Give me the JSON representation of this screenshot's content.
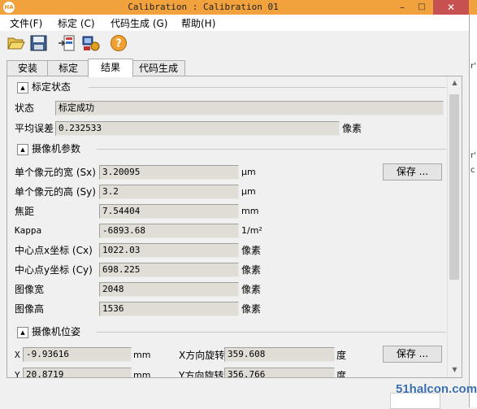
{
  "window": {
    "title": "Calibration : Calibration 01",
    "app_icon": "HA",
    "min": "–",
    "max": "□",
    "close": "✕"
  },
  "menu": [
    "文件(F)",
    "标定 (C)",
    "代码生成 (G)",
    "帮助(H)"
  ],
  "toolbar_icons": [
    "open-folder-icon",
    "save-disk-icon",
    "import-icon",
    "camera-settings-icon",
    "help-icon"
  ],
  "tabs": [
    "安装",
    "标定",
    "结果",
    "代码生成"
  ],
  "active_tab": "结果",
  "sections": {
    "calib_status": "标定状态",
    "camera_params": "摄像机参数",
    "camera_pose": "摄像机位姿"
  },
  "status": {
    "state_label": "状态",
    "state_value": "标定成功",
    "mean_error_label": "平均误差",
    "mean_error_value": "0.232533",
    "mean_error_unit": "像素"
  },
  "params": [
    {
      "label": "单个像元的宽 (Sx)",
      "value": "3.20095",
      "unit": "μm"
    },
    {
      "label": "单个像元的高 (Sy)",
      "value": "3.2",
      "unit": "μm"
    },
    {
      "label": "焦距",
      "value": "7.54404",
      "unit": "mm"
    },
    {
      "label": "Kappa",
      "value": "-6893.68",
      "unit": "1/m²"
    },
    {
      "label": "中心点x坐标 (Cx)",
      "value": "1022.03",
      "unit": "像素"
    },
    {
      "label": "中心点y坐标 (Cy)",
      "value": "698.225",
      "unit": "像素"
    },
    {
      "label": "图像宽",
      "value": "2048",
      "unit": "像素"
    },
    {
      "label": "图像高",
      "value": "1536",
      "unit": "像素"
    }
  ],
  "save_label": "保存 ...",
  "pose": {
    "x_label": "X",
    "x_value": "-9.93616",
    "x_unit": "mm",
    "xrot_label": "X方向旋转",
    "xrot_value": "359.608",
    "xrot_unit": "度",
    "y_label": "Y",
    "y_value": "20.8719",
    "y_unit": "mm",
    "yrot_label": "Y方向旋转",
    "yrot_value": "356.766",
    "yrot_unit": "度"
  },
  "side_chars": [
    "r'",
    "r'",
    "c"
  ],
  "watermark": "51halcon.com"
}
